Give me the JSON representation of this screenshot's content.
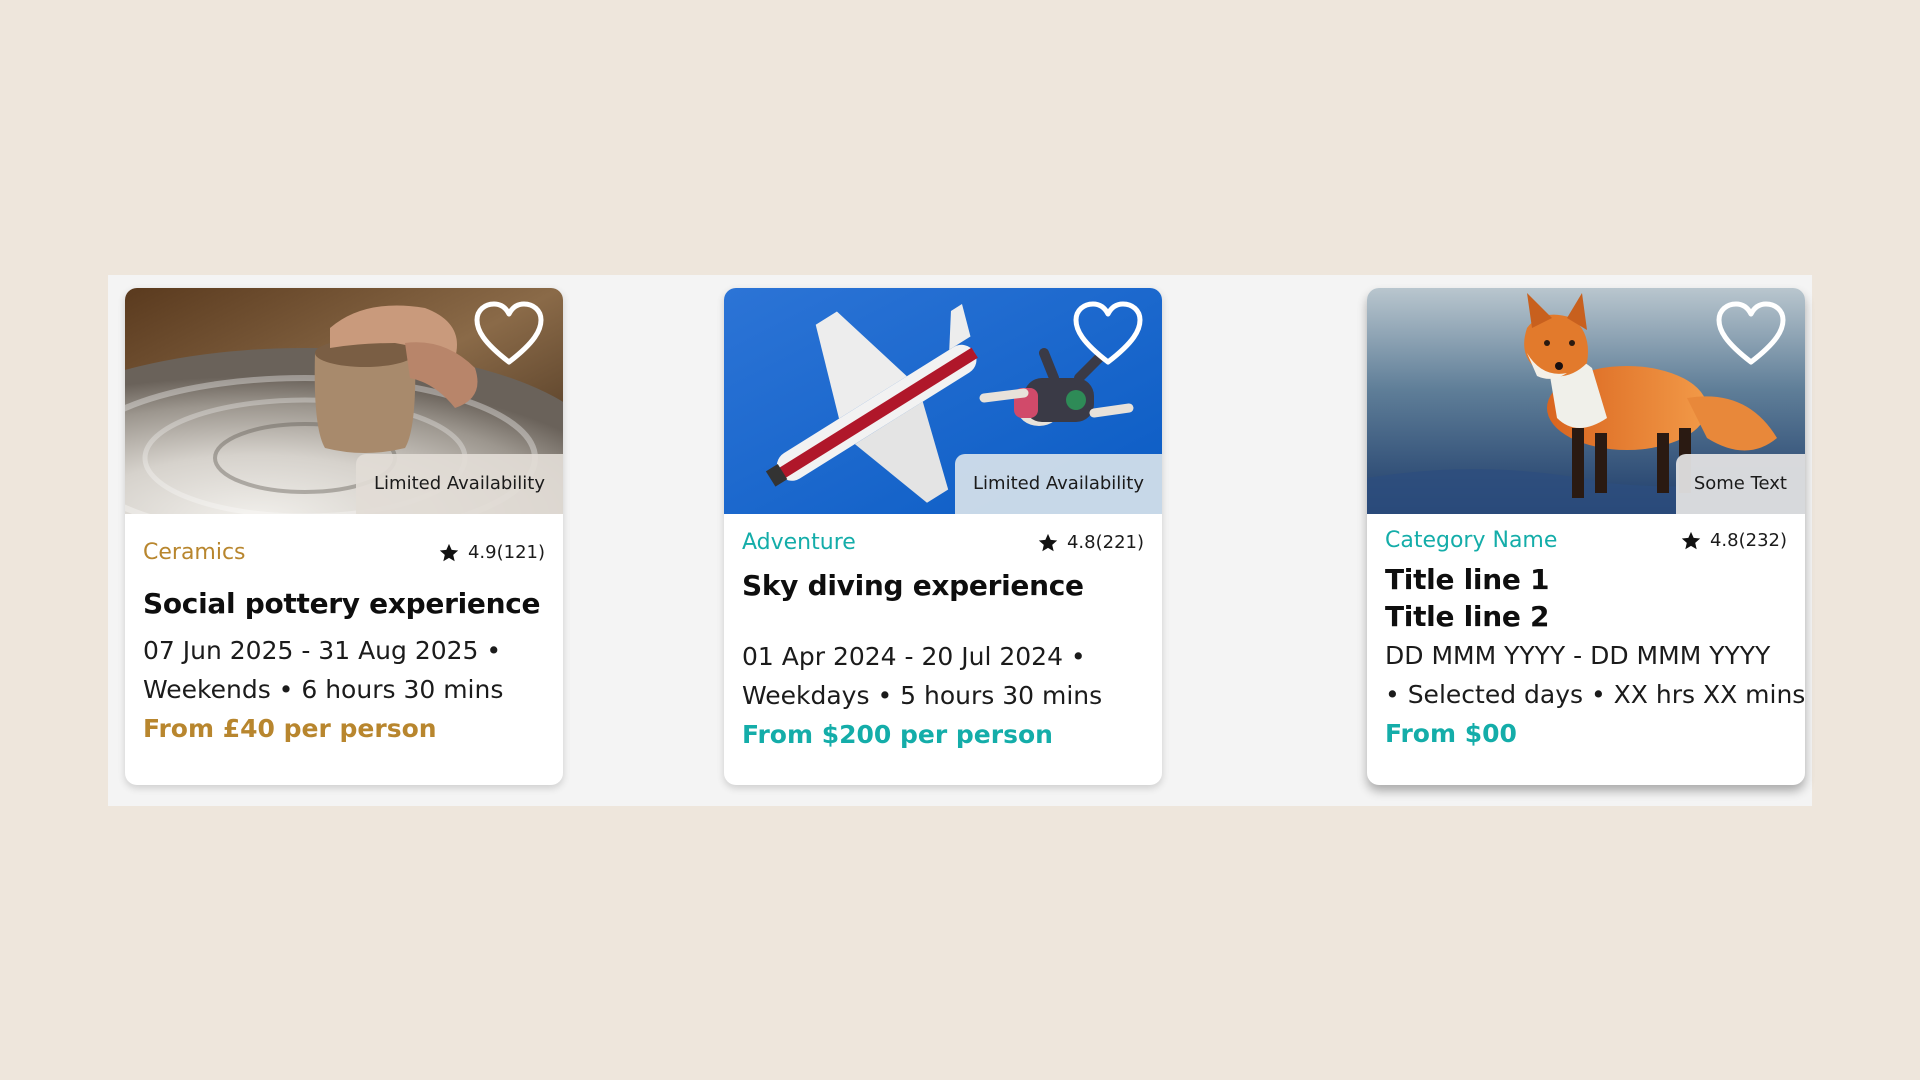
{
  "cards": [
    {
      "badge": "Limited Availability",
      "category": "Ceramics",
      "rating": "4.9(121)",
      "title_lines": [
        "Social pottery experience"
      ],
      "date_line": "07 Jun 2025 - 31 Aug 2025 •",
      "days_line": "Weekends • 6 hours 30 mins",
      "price": "From £40 per person",
      "accent": "#B8862E",
      "image": "pottery-wheel-photo"
    },
    {
      "badge": "Limited Availability",
      "category": "Adventure",
      "rating": "4.8(221)",
      "title_lines": [
        "Sky diving experience"
      ],
      "date_line": "01 Apr 2024 - 20 Jul 2024 •",
      "days_line": "Weekdays • 5 hours 30 mins",
      "price": "From $200 per person",
      "accent": "#14ADA9",
      "image": "skydiving-plane-photo"
    },
    {
      "badge": "Some Text",
      "category": "Category Name",
      "rating": "4.8(232)",
      "title_lines": [
        "Title line 1",
        "Title line 2"
      ],
      "date_line": "DD MMM YYYY - DD MMM YYYY",
      "days_line": "• Selected days • XX hrs XX mins",
      "price": "From $00",
      "accent": "#14ADA9",
      "image": "red-fox-photo"
    }
  ],
  "icons": {
    "favorite": "heart-outline-icon",
    "rating": "star-icon"
  },
  "colors": {
    "background": "#EEE6DC",
    "panel": "#F4F4F4",
    "ceramics_accent": "#B8862E",
    "teal_accent": "#14ADA9"
  }
}
